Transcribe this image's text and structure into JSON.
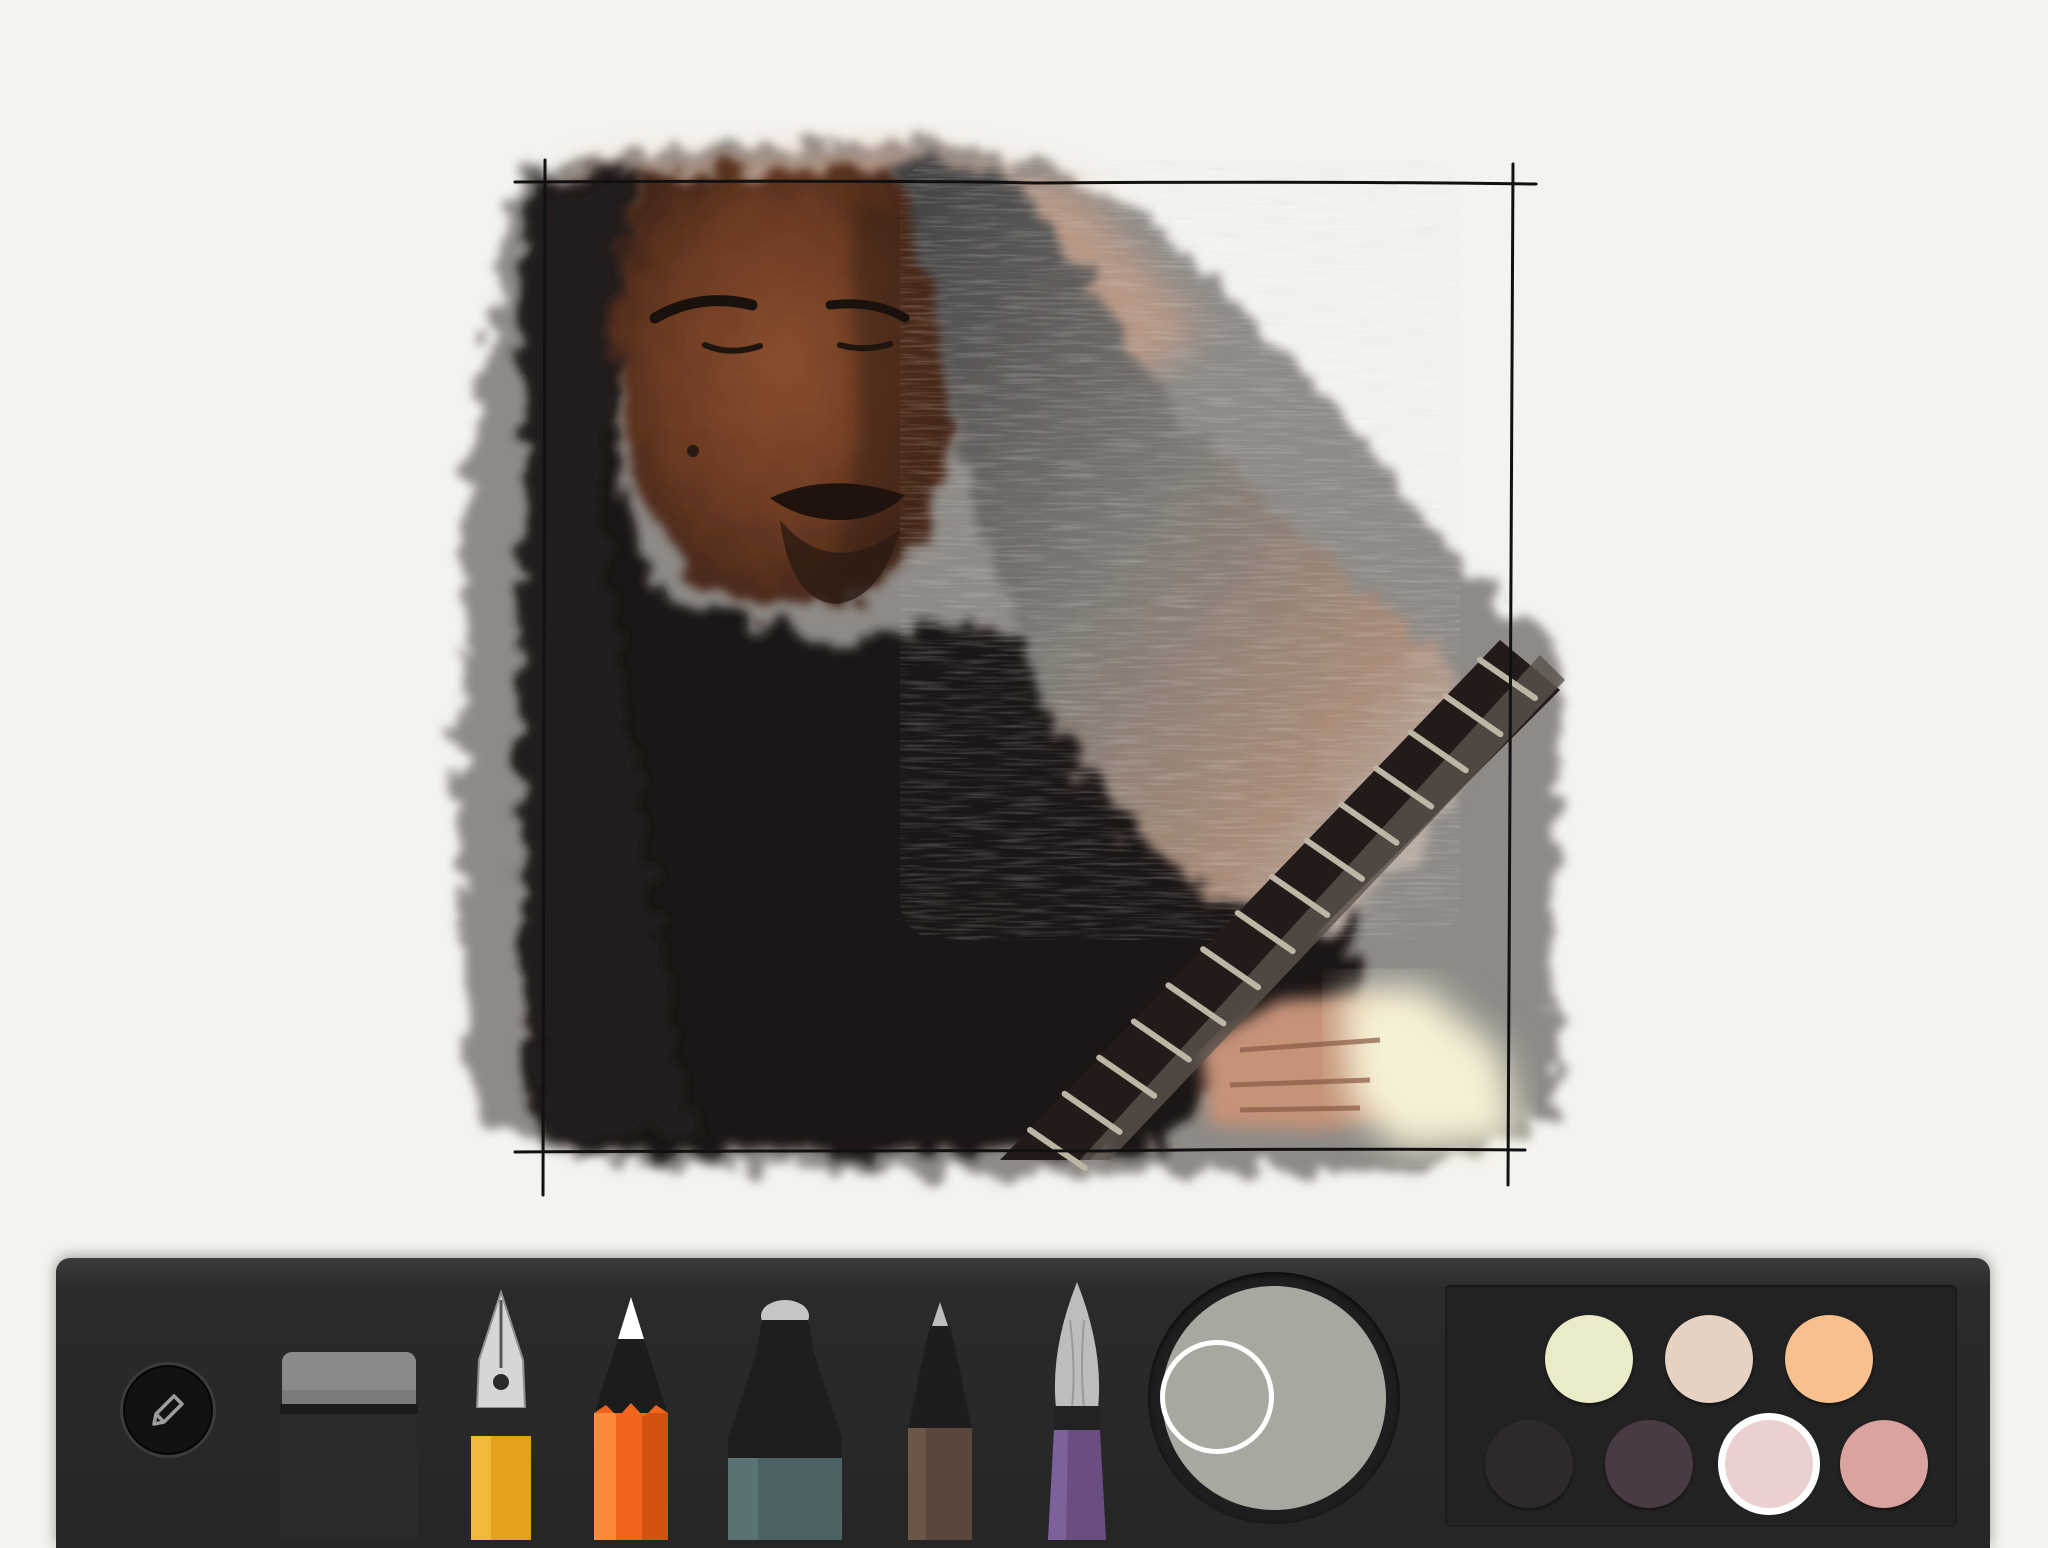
{
  "app": {
    "canvas_background": "#f4f3ef",
    "toolbar_background": "#262626"
  },
  "canvas": {
    "artwork_description_icon": "watercolor-portrait-drawing",
    "frame_line_color": "#111111"
  },
  "toolbar": {
    "menu_icon": "pencil-icon",
    "tools": [
      {
        "name": "eraser",
        "icon": "eraser-icon",
        "color": "#8a8a8a"
      },
      {
        "name": "fountain-pen",
        "icon": "fountain-pen-icon",
        "color": "#e4a21c"
      },
      {
        "name": "pencil",
        "icon": "pencil-icon",
        "color": "#f0641d",
        "selected": true
      },
      {
        "name": "marker",
        "icon": "marker-icon",
        "color": "#4c6264"
      },
      {
        "name": "fineliner",
        "icon": "fineliner-icon",
        "color": "#5a463a"
      },
      {
        "name": "watercolor-brush",
        "icon": "brush-icon",
        "color": "#6a4e82"
      }
    ],
    "current_color": "#a9a8a0",
    "swatches": [
      {
        "color": "#ecebc7"
      },
      {
        "color": "#e6d2c3"
      },
      {
        "color": "#f8c08e"
      },
      {
        "color": "#2e2a2a"
      },
      {
        "color": "#4a3a44"
      },
      {
        "color": "#ead0d0",
        "selected": true
      },
      {
        "color": "#d9a39f"
      }
    ]
  }
}
